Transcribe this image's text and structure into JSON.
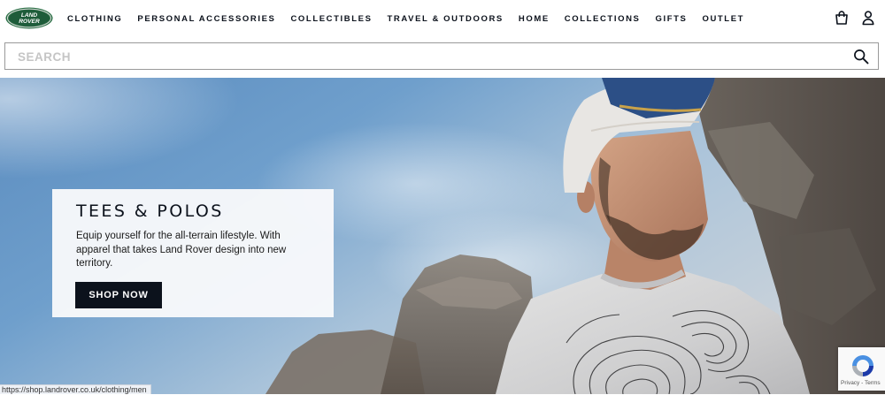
{
  "brand": {
    "logo_text_line1": "LAND",
    "logo_text_line2": "ROVER",
    "logo_color": "#1e5c3a"
  },
  "nav": {
    "items": [
      {
        "label": "CLOTHING"
      },
      {
        "label": "PERSONAL ACCESSORIES"
      },
      {
        "label": "COLLECTIBLES"
      },
      {
        "label": "TRAVEL & OUTDOORS"
      },
      {
        "label": "HOME"
      },
      {
        "label": "COLLECTIONS"
      },
      {
        "label": "GIFTS"
      },
      {
        "label": "OUTLET"
      }
    ]
  },
  "header_icons": {
    "cart": "shopping-bag-icon",
    "account": "user-icon"
  },
  "search": {
    "placeholder": "SEARCH",
    "value": "",
    "icon": "search-icon"
  },
  "hero": {
    "promo": {
      "title": "TEES & POLOS",
      "description": "Equip yourself for the all-terrain lifestyle. With apparel that takes Land Rover design into new territory.",
      "cta_label": "SHOP NOW"
    }
  },
  "status_bar": {
    "url": "https://shop.landrover.co.uk/clothing/men"
  },
  "recaptcha": {
    "label": "Privacy - Terms"
  },
  "colors": {
    "text": "#0c121c",
    "button_bg": "#0c121c",
    "button_text": "#ffffff",
    "sky": "#6f9fcc"
  }
}
